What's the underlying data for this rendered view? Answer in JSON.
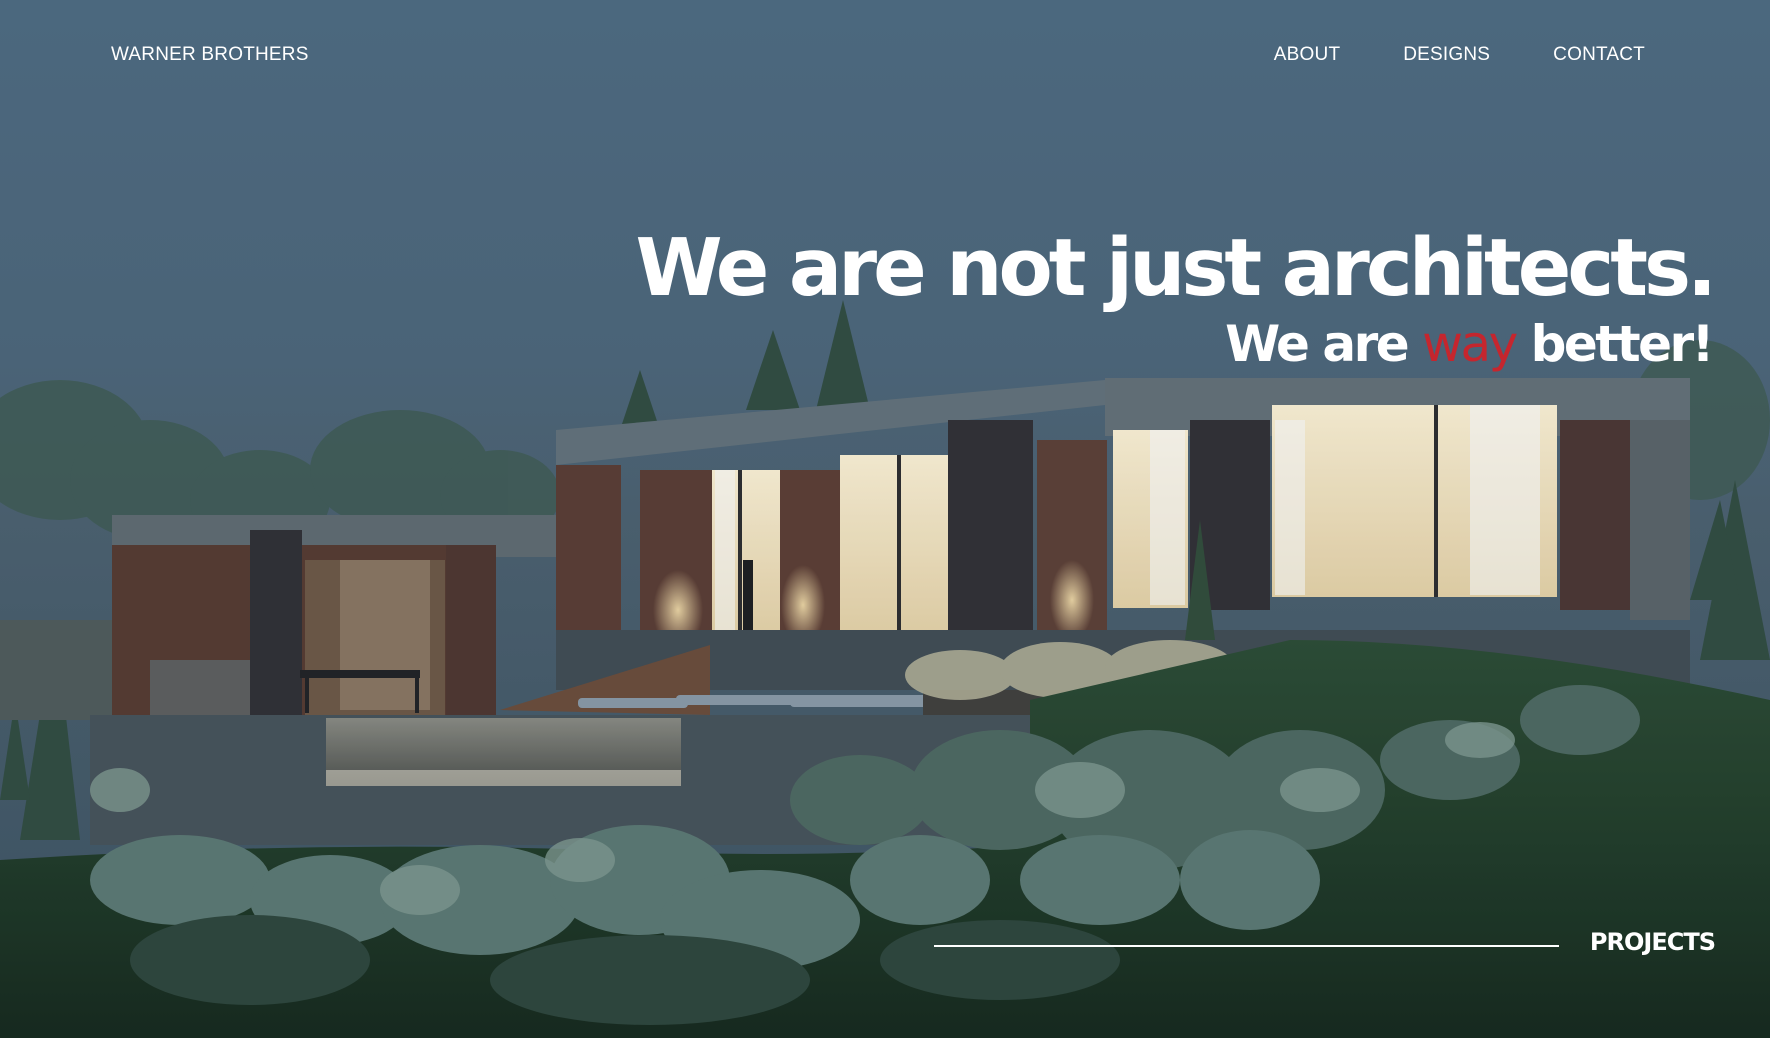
{
  "nav": {
    "brand": "WARNER BROTHERS",
    "links": [
      {
        "label": "ABOUT"
      },
      {
        "label": "DESIGNS"
      },
      {
        "label": "CONTACT"
      }
    ]
  },
  "hero": {
    "headline": "We are not just architects.",
    "subheadline_prefix": "We are",
    "subheadline_accent": "way",
    "subheadline_suffix": "better!",
    "accent_color": "#c5262e"
  },
  "footer": {
    "projects_label": "PROJECTS"
  }
}
